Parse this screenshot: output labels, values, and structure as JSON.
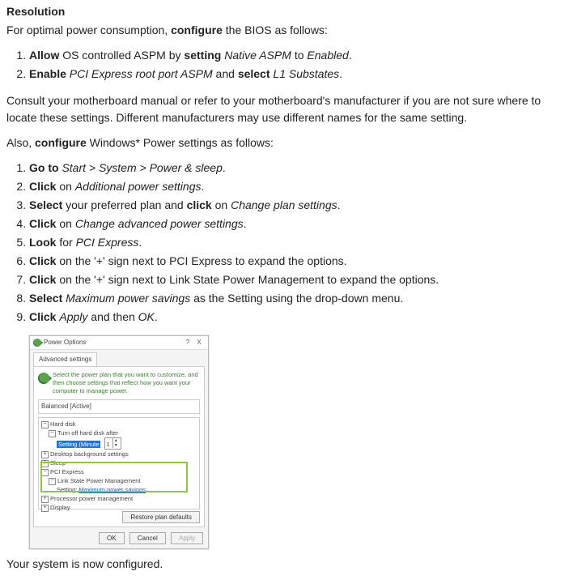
{
  "heading": "Resolution",
  "intro": {
    "p1a": "For optimal power consumption, ",
    "p1b": "configure",
    "p1c": " the BIOS as follows:"
  },
  "biosList": {
    "i1": {
      "b1": "Allow",
      "t1": " OS controlled ASPM by ",
      "b2": "setting",
      "t2": " ",
      "i1": "Native ASPM",
      "t3": " to ",
      "i2": "Enabled",
      "t4": "."
    },
    "i2": {
      "b1": "Enable",
      "t1": " ",
      "i1": "PCI Express root port ASPM",
      "t2": " and ",
      "b2": "select",
      "t3": " ",
      "i2": "L1 Substates",
      "t4": "."
    }
  },
  "consult": "Consult your motherboard manual or refer to your motherboard's manufacturer if you are not sure where to locate these settings. Different manufacturers may use different names for the same setting.",
  "also": {
    "a": "Also, ",
    "b": "configure",
    "c": " Windows* Power settings as follows:"
  },
  "winList": {
    "s1": {
      "b": "Go to",
      "t1": " ",
      "i": "Start > System > Power & sleep",
      "t2": "."
    },
    "s2": {
      "b": "Click",
      "t1": " on ",
      "i": "Additional power settings",
      "t2": "."
    },
    "s3": {
      "b1": "Select",
      "t1": " your preferred plan and ",
      "b2": "click",
      "t2": " on ",
      "i": "Change plan settings",
      "t3": "."
    },
    "s4": {
      "b": "Click",
      "t1": " on ",
      "i": "Change advanced power settings",
      "t2": "."
    },
    "s5": {
      "b": "Look",
      "t1": " for ",
      "i": "PCI Express",
      "t2": "."
    },
    "s6": {
      "b": "Click",
      "t": " on the '+' sign next to PCI Express to expand the options."
    },
    "s7": {
      "b": "Click",
      "t": " on the '+' sign next to Link State Power Management to expand the options."
    },
    "s8": {
      "b": "Select",
      "t1": " ",
      "i": "Maximum power savings",
      "t2": " as the Setting using the drop-down menu."
    },
    "s9": {
      "b1": "Click",
      "t1": " ",
      "i1": "Apply",
      "t2": " and then ",
      "i2": "OK",
      "t3": "."
    }
  },
  "dialog": {
    "title": "Power Options",
    "help": "?",
    "close": "X",
    "tab": "Advanced settings",
    "msg": "Select the power plan that you want to customize, and then choose settings that reflect how you want your computer to manage power.",
    "plan": "Balanced [Active]",
    "tree": {
      "hardDisk": "Hard disk",
      "turnOff": "Turn off hard disk after",
      "settingMin": "Setting (Minute",
      "settingVal": "1",
      "desktopBg": "Desktop background settings",
      "sleep": "Sleep",
      "pciExpress": "PCI Express",
      "linkState": "Link State Power Management",
      "settingLabel": "Setting: ",
      "settingValue": "Maximum power savings",
      "procPower": "Processor power management",
      "display": "Display"
    },
    "restore": "Restore plan defaults",
    "ok": "OK",
    "cancel": "Cancel",
    "apply": "Apply"
  },
  "closing": "Your system is now configured."
}
